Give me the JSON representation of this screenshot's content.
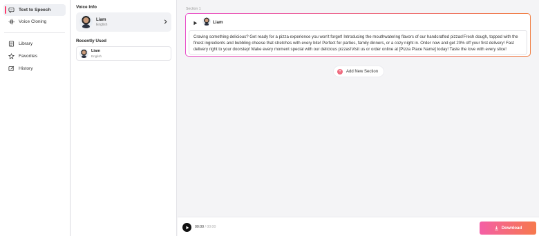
{
  "nav": {
    "items": [
      {
        "label": "Text to Speech",
        "icon": "speech-bubble-icon",
        "active": true
      },
      {
        "label": "Voice Cloning",
        "icon": "waveform-icon"
      },
      {
        "label": "Library",
        "icon": "library-icon"
      },
      {
        "label": "Favorites",
        "icon": "star-icon"
      },
      {
        "label": "History",
        "icon": "history-icon"
      }
    ],
    "accent_color": "#ff3b6b"
  },
  "voice_panel": {
    "info_title": "Voice Info",
    "current_voice": {
      "name": "Liam",
      "language": "English"
    },
    "recent_title": "Recently Used",
    "recent": [
      {
        "name": "Liam",
        "language": "English"
      }
    ]
  },
  "section": {
    "label": "Section 1",
    "voice_name": "Liam",
    "text": "Craving something delicious? Get ready for a pizza experience you won't forget! Introducing the mouthwatering flavors of our handcrafted pizzas!Fresh dough, topped with the finest ingredients and bubbling cheese that stretches with every bite! Perfect for parties, family dinners, or a cozy night in. Order now and get 20% off your first delivery! Fast delivery right to your doorstep! Make every moment special with our delicious pizzas!Visit us or order online at [Pizza Place Name] today! Taste the love with every slice!"
  },
  "add_section_label": "Add New Section",
  "player": {
    "current": "00:00",
    "separator": "/",
    "total": "00:00"
  },
  "download_label": "Download",
  "colors": {
    "gradient_start": "#f45fa6",
    "gradient_end": "#f6794c"
  }
}
